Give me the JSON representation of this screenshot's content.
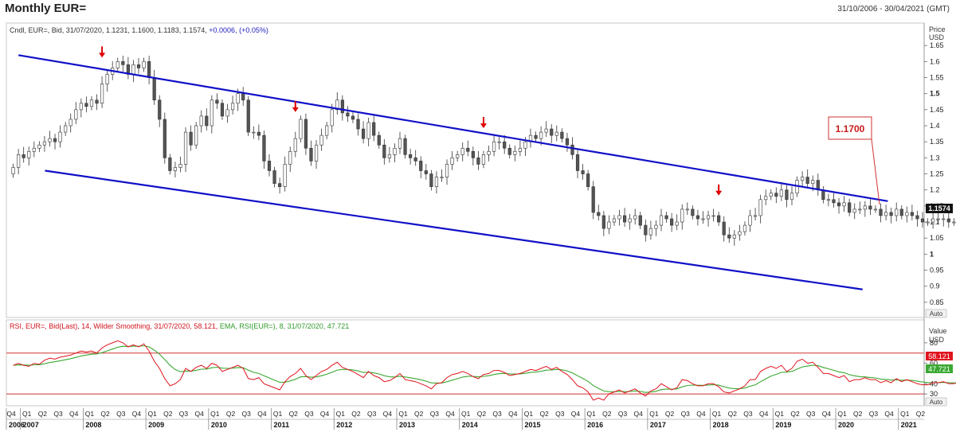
{
  "title": "Monthly EUR=",
  "date_range": "31/10/2006 - 30/04/2021 (GMT)",
  "colors": {
    "channel": "#1010c8",
    "rsi": "#e0141e",
    "ema": "#3aa832",
    "arrow": "#e00000",
    "up_fill": "#ffffff",
    "down_fill": "#555555",
    "bounds": "#d23030"
  },
  "price_panel": {
    "info": "Cndl, EUR=, Bid, 31/07/2020, 1.1231, 1.1600, 1.1183, 1.1574, ",
    "info_change": "+0.0006, (+0.05%)",
    "axis_title": [
      "Price",
      "USD"
    ],
    "ticks": [
      "1.65",
      "1.6",
      "1.55",
      "1.5",
      "1.45",
      "1.4",
      "1.35",
      "1.3",
      "1.25",
      "1.2",
      "1.15",
      "1.1",
      "1.05",
      "1",
      "0.95",
      "0.9",
      "0.85"
    ],
    "bold_ticks": [
      "1.5",
      "1"
    ],
    "last_price": "1.1574",
    "callout": "1.1700",
    "auto": "Auto"
  },
  "rsi_panel": {
    "info_rsi": "RSI, EUR=, Bid(Last), 14, Wilder Smoothing, 31/07/2020, 58.121, ",
    "info_ema": "EMA, RSI(EUR=), 8, 31/07/2020, 47.721",
    "axis_title": [
      "Value",
      "USD"
    ],
    "ticks": [
      "80",
      "60",
      "40",
      "30"
    ],
    "rsi_last": "58.121",
    "ema_last": "47.721",
    "auto": "Auto"
  },
  "x_axis": {
    "quarters": [
      "Q4",
      "Q1",
      "Q2",
      "Q3",
      "Q4",
      "Q1",
      "Q2",
      "Q3",
      "Q4",
      "Q1",
      "Q2",
      "Q3",
      "Q4",
      "Q1",
      "Q2",
      "Q3",
      "Q4",
      "Q1",
      "Q2",
      "Q3",
      "Q4",
      "Q1",
      "Q2",
      "Q3",
      "Q4",
      "Q1",
      "Q2",
      "Q3",
      "Q4",
      "Q1",
      "Q2",
      "Q3",
      "Q4",
      "Q1",
      "Q2",
      "Q3",
      "Q4",
      "Q1",
      "Q2",
      "Q3",
      "Q4",
      "Q1",
      "Q2",
      "Q3",
      "Q4",
      "Q1",
      "Q2",
      "Q3",
      "Q4",
      "Q1",
      "Q2",
      "Q3",
      "Q4",
      "Q1",
      "Q2",
      "Q3",
      "Q4",
      "Q1",
      "Q2"
    ],
    "years": [
      "2006",
      "2007",
      "2008",
      "2009",
      "2010",
      "2011",
      "2012",
      "2013",
      "2014",
      "2015",
      "2016",
      "2017",
      "2018",
      "2019",
      "2020",
      "2021"
    ]
  },
  "chart_data": {
    "type": "candlestick",
    "period": "monthly",
    "candles_close": [
      1.27,
      1.31,
      1.3,
      1.32,
      1.33,
      1.34,
      1.35,
      1.36,
      1.35,
      1.38,
      1.4,
      1.42,
      1.45,
      1.47,
      1.46,
      1.48,
      1.47,
      1.53,
      1.56,
      1.58,
      1.6,
      1.59,
      1.56,
      1.59,
      1.58,
      1.6,
      1.55,
      1.48,
      1.42,
      1.3,
      1.26,
      1.27,
      1.28,
      1.38,
      1.34,
      1.4,
      1.43,
      1.4,
      1.48,
      1.47,
      1.43,
      1.45,
      1.47,
      1.5,
      1.48,
      1.38,
      1.38,
      1.37,
      1.29,
      1.26,
      1.22,
      1.21,
      1.28,
      1.32,
      1.36,
      1.42,
      1.33,
      1.29,
      1.34,
      1.37,
      1.4,
      1.45,
      1.48,
      1.44,
      1.43,
      1.42,
      1.39,
      1.36,
      1.41,
      1.37,
      1.34,
      1.3,
      1.31,
      1.33,
      1.36,
      1.31,
      1.3,
      1.29,
      1.26,
      1.25,
      1.21,
      1.24,
      1.24,
      1.28,
      1.3,
      1.31,
      1.33,
      1.32,
      1.3,
      1.28,
      1.31,
      1.32,
      1.35,
      1.35,
      1.33,
      1.31,
      1.32,
      1.33,
      1.35,
      1.37,
      1.36,
      1.38,
      1.39,
      1.37,
      1.38,
      1.36,
      1.34,
      1.31,
      1.26,
      1.25,
      1.21,
      1.13,
      1.12,
      1.08,
      1.1,
      1.11,
      1.12,
      1.1,
      1.11,
      1.12,
      1.09,
      1.06,
      1.08,
      1.09,
      1.12,
      1.11,
      1.09,
      1.1,
      1.14,
      1.14,
      1.12,
      1.11,
      1.11,
      1.12,
      1.12,
      1.1,
      1.06,
      1.05,
      1.06,
      1.07,
      1.09,
      1.12,
      1.12,
      1.17,
      1.18,
      1.19,
      1.18,
      1.2,
      1.17,
      1.19,
      1.23,
      1.24,
      1.22,
      1.23,
      1.2,
      1.17,
      1.17,
      1.16,
      1.15,
      1.16,
      1.13,
      1.14,
      1.14,
      1.15,
      1.14,
      1.14,
      1.12,
      1.13,
      1.12,
      1.14,
      1.12,
      1.13,
      1.12,
      1.11,
      1.1,
      1.1,
      1.11,
      1.11,
      1.11,
      1.1,
      1.1,
      1.11,
      1.12,
      1.1,
      1.09,
      1.11,
      1.12,
      1.16
    ],
    "last_candle": {
      "date": "31/07/2020",
      "open": 1.1231,
      "high": 1.16,
      "low": 1.1183,
      "close": 1.1574,
      "change": 0.0006,
      "change_pct": 0.05
    },
    "channel_upper": [
      {
        "x": "2006-12",
        "y": 1.62
      },
      {
        "x": "2020-07",
        "y": 1.17
      }
    ],
    "channel_lower": [
      {
        "x": "2007-06",
        "y": 1.26
      },
      {
        "x": "2020-04",
        "y": 0.89
      }
    ],
    "touch_arrows": [
      "2008-04",
      "2011-05",
      "2014-05",
      "2018-02"
    ],
    "upper_line_target": 1.17,
    "y_range": [
      0.82,
      1.7
    ],
    "rsi": {
      "period": 14,
      "smoothing": "Wilder",
      "last": 58.121,
      "overbought": 70,
      "oversold": 30,
      "values": [
        58,
        60,
        58,
        57,
        60,
        59,
        63,
        65,
        64,
        66,
        67,
        68,
        70,
        72,
        71,
        72,
        70,
        75,
        78,
        80,
        82,
        80,
        76,
        78,
        76,
        79,
        72,
        62,
        55,
        45,
        38,
        40,
        44,
        55,
        52,
        56,
        58,
        55,
        60,
        58,
        52,
        54,
        56,
        58,
        55,
        45,
        44,
        46,
        40,
        38,
        36,
        34,
        42,
        47,
        50,
        55,
        48,
        44,
        48,
        52,
        54,
        58,
        61,
        56,
        54,
        52,
        49,
        46,
        52,
        48,
        46,
        42,
        43,
        46,
        50,
        44,
        43,
        42,
        40,
        38,
        35,
        40,
        41,
        46,
        49,
        50,
        52,
        50,
        47,
        45,
        49,
        50,
        53,
        53,
        51,
        48,
        49,
        50,
        52,
        54,
        53,
        55,
        57,
        54,
        56,
        52,
        49,
        44,
        38,
        36,
        32,
        24,
        26,
        24,
        30,
        32,
        34,
        31,
        33,
        35,
        31,
        28,
        33,
        35,
        40,
        37,
        34,
        36,
        44,
        43,
        40,
        38,
        38,
        40,
        40,
        37,
        32,
        31,
        33,
        35,
        38,
        44,
        44,
        52,
        55,
        57,
        55,
        58,
        52,
        55,
        62,
        64,
        60,
        61,
        56,
        50,
        50,
        48,
        46,
        48,
        42,
        44,
        44,
        46,
        44,
        44,
        41,
        43,
        41,
        45,
        42,
        44,
        42,
        40,
        39,
        39,
        41,
        41,
        42,
        40,
        40,
        42,
        44,
        40,
        38,
        42,
        45,
        58
      ]
    },
    "ema": {
      "period": 8,
      "last": 47.721
    },
    "rsi_range": [
      20,
      90
    ]
  }
}
